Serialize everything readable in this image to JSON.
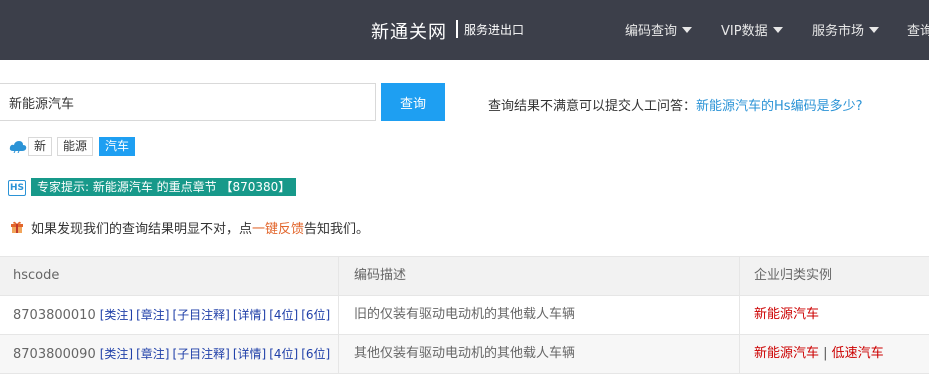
{
  "header": {
    "brand": "新通关网",
    "brand_sub": "服务进出口",
    "nav": [
      "编码查询",
      "VIP数据",
      "服务市场",
      "查询"
    ]
  },
  "search": {
    "value": "新能源汽车",
    "button": "查询",
    "hint_prefix": "查询结果不满意可以提交人工问答：",
    "hint_link": "新能源汽车的Hs编码是多少?"
  },
  "tags": [
    "新",
    "能源",
    "汽车"
  ],
  "expert_tip": {
    "icon_text": "HS",
    "text": "专家提示: 新能源汽车 的重点章节 【870380】"
  },
  "feedback": {
    "before": "如果发现我们的查询结果明显不对，点",
    "link": "一键反馈",
    "after": "告知我们。"
  },
  "table": {
    "columns": [
      "hscode",
      "编码描述",
      "企业归类实例"
    ],
    "rows": [
      {
        "code": "8703800010",
        "links": [
          "[类注]",
          "[章注]",
          "[子目注释]",
          "[详情]",
          "[4位]",
          "[6位]"
        ],
        "desc": "旧的仅装有驱动电动机的其他载人车辆",
        "examples": [
          "新能源汽车"
        ]
      },
      {
        "code": "8703800090",
        "links": [
          "[类注]",
          "[章注]",
          "[子目注释]",
          "[详情]",
          "[4位]",
          "[6位]"
        ],
        "desc": "其他仅装有驱动电动机的其他载人车辆",
        "examples": [
          "新能源汽车",
          "低速汽车"
        ]
      }
    ]
  },
  "colors": {
    "topbar": "#3c3f4a",
    "accent": "#1e9ff2",
    "tip": "#17998a",
    "feedback_link": "#e2652b",
    "example_red": "#cc0000"
  }
}
